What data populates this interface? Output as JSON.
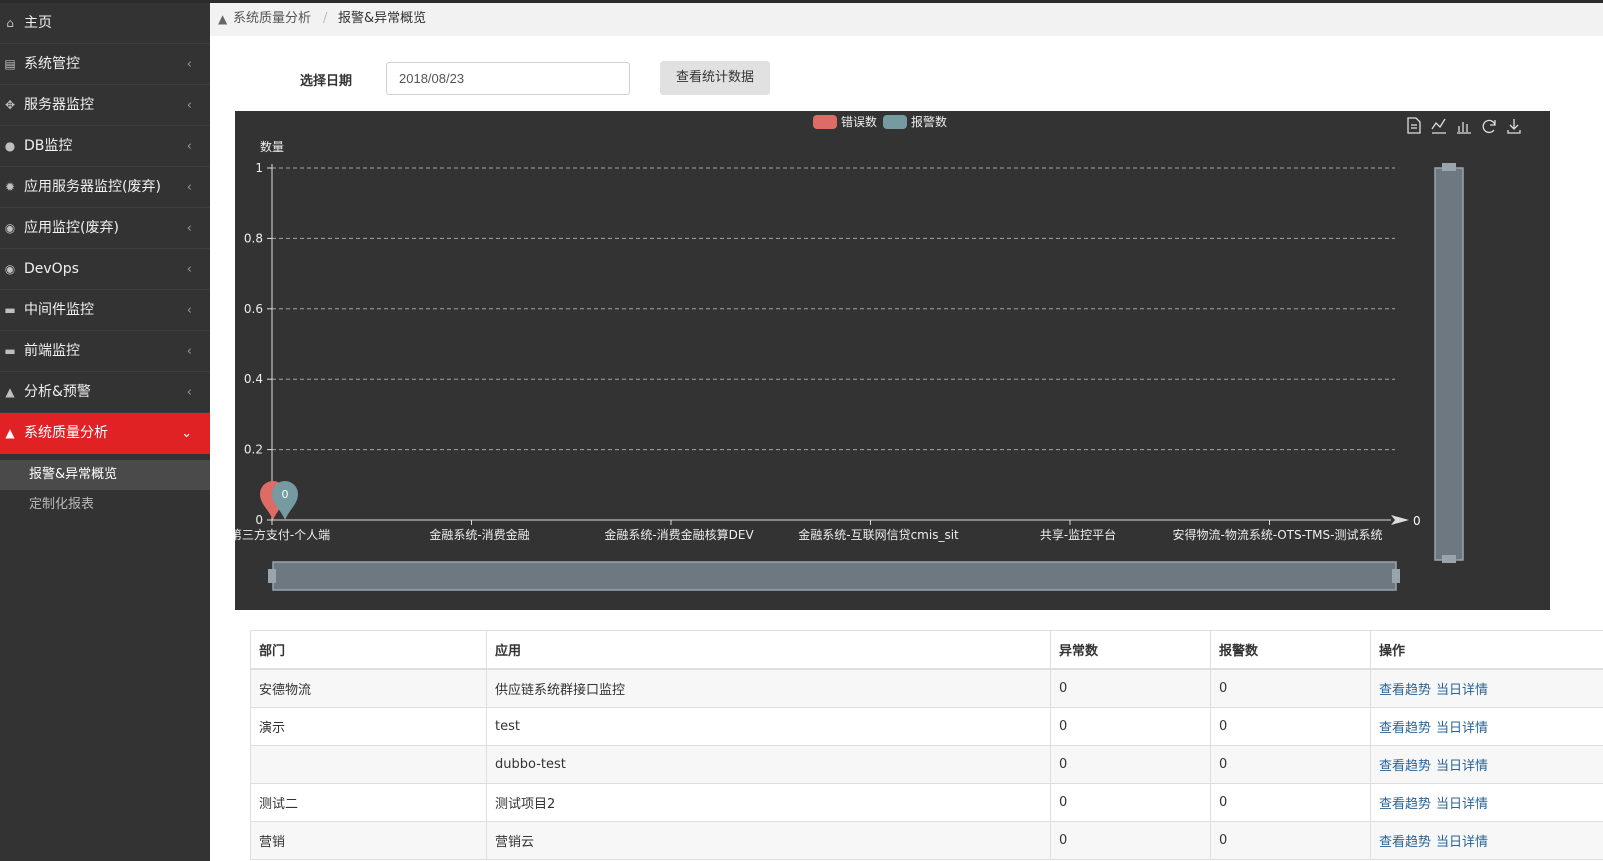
{
  "sidebar": {
    "items": [
      {
        "label": "主页",
        "icon": "home-icon"
      },
      {
        "label": "系统管控",
        "icon": "server-rack-icon"
      },
      {
        "label": "服务器监控",
        "icon": "target-icon"
      },
      {
        "label": "DB监控",
        "icon": "globe-icon"
      },
      {
        "label": "应用服务器监控(废弃)",
        "icon": "gear-icon"
      },
      {
        "label": "应用监控(废弃)",
        "icon": "eye-icon"
      },
      {
        "label": "DevOps",
        "icon": "eye-icon"
      },
      {
        "label": "中间件监控",
        "icon": "briefcase-icon"
      },
      {
        "label": "前端监控",
        "icon": "briefcase-icon"
      },
      {
        "label": "分析&预警",
        "icon": "bell-icon"
      },
      {
        "label": "系统质量分析",
        "icon": "bell-icon",
        "active": true
      }
    ],
    "chevron": "‹",
    "chevron_open": "⌄",
    "submenu": [
      {
        "label": "报警&异常概览",
        "selected": true
      },
      {
        "label": "定制化报表"
      }
    ]
  },
  "breadcrumb": {
    "parent": "系统质量分析",
    "separator": "/",
    "current": "报警&异常概览"
  },
  "filter": {
    "label": "选择日期",
    "date_value": "2018/08/23",
    "button_label": "查看统计数据"
  },
  "colors": {
    "error": "#dd6b66",
    "alarm": "#759aa0",
    "active_menu": "#e02225",
    "link": "#2a6496",
    "chart_bg": "#333333"
  },
  "chart_data": {
    "type": "bar",
    "legend": [
      "错误数",
      "报警数"
    ],
    "legend_position": "top-center",
    "ylabel": "数量",
    "yticks": [
      "1",
      "0.8",
      "0.6",
      "0.4",
      "0.2",
      "0"
    ],
    "ylim": [
      0,
      1
    ],
    "grid": true,
    "categories": [
      "第三方支付-个人端",
      "金融系统-消费金融",
      "金融系统-消费金融核算DEV",
      "金融系统-互联网信贷cmis_sit",
      "共享-监控平台",
      "安得物流-物流系统-OTS-TMS-测试系统"
    ],
    "series": [
      {
        "name": "错误数",
        "values": [
          0,
          0,
          0,
          0,
          0,
          0
        ]
      },
      {
        "name": "报警数",
        "values": [
          0,
          0,
          0,
          0,
          0,
          0
        ]
      }
    ],
    "marker_label": "0",
    "axis_end_label": "0",
    "toolbox": [
      "data-view-icon",
      "line-chart-icon",
      "bar-chart-icon",
      "refresh-icon",
      "download-icon"
    ]
  },
  "table": {
    "headers": [
      "部门",
      "应用",
      "异常数",
      "报警数",
      "操作"
    ],
    "rows": [
      {
        "dept": "安德物流",
        "app": "供应链系统群接口监控",
        "errors": "0",
        "alarms": "0",
        "trend": "查看趋势",
        "detail": "当日详情"
      },
      {
        "dept": "演示",
        "app": "test",
        "errors": "0",
        "alarms": "0",
        "trend": "查看趋势",
        "detail": "当日详情"
      },
      {
        "dept": "",
        "app": "dubbo-test",
        "errors": "0",
        "alarms": "0",
        "trend": "查看趋势",
        "detail": "当日详情"
      },
      {
        "dept": "测试二",
        "app": "测试项目2",
        "errors": "0",
        "alarms": "0",
        "trend": "查看趋势",
        "detail": "当日详情"
      },
      {
        "dept": "营销",
        "app": "营销云",
        "errors": "0",
        "alarms": "0",
        "trend": "查看趋势",
        "detail": "当日详情"
      }
    ]
  }
}
